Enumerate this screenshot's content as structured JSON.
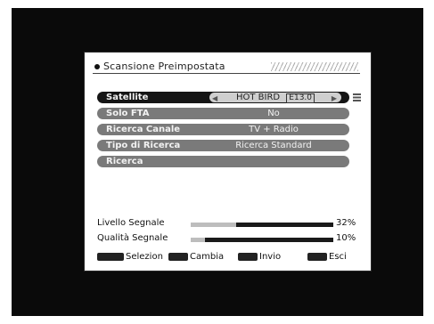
{
  "menu": {
    "title": "Scansione Preimpostata"
  },
  "rows": [
    {
      "label": "Satellite",
      "value": "HOT BIRD",
      "badge": "E13.0"
    },
    {
      "label": "Solo FTA",
      "value": "No"
    },
    {
      "label": "Ricerca Canale",
      "value": "TV + Radio"
    },
    {
      "label": "Tipo di Ricerca",
      "value": "Ricerca Standard"
    },
    {
      "label": "Ricerca",
      "value": ""
    }
  ],
  "signal": {
    "level_label": "Livello Segnale",
    "level_pct": "32%",
    "level_value": 0.32,
    "quality_label": "Qualità Segnale",
    "quality_pct": "10%",
    "quality_value": 0.1
  },
  "help": {
    "select": "Selezion",
    "change": "Cambia",
    "send": "Invio",
    "exit": "Esci"
  },
  "icons": {
    "arrow_left": "arrow-left-icon",
    "arrow_right": "arrow-right-icon",
    "list": "list-icon"
  }
}
